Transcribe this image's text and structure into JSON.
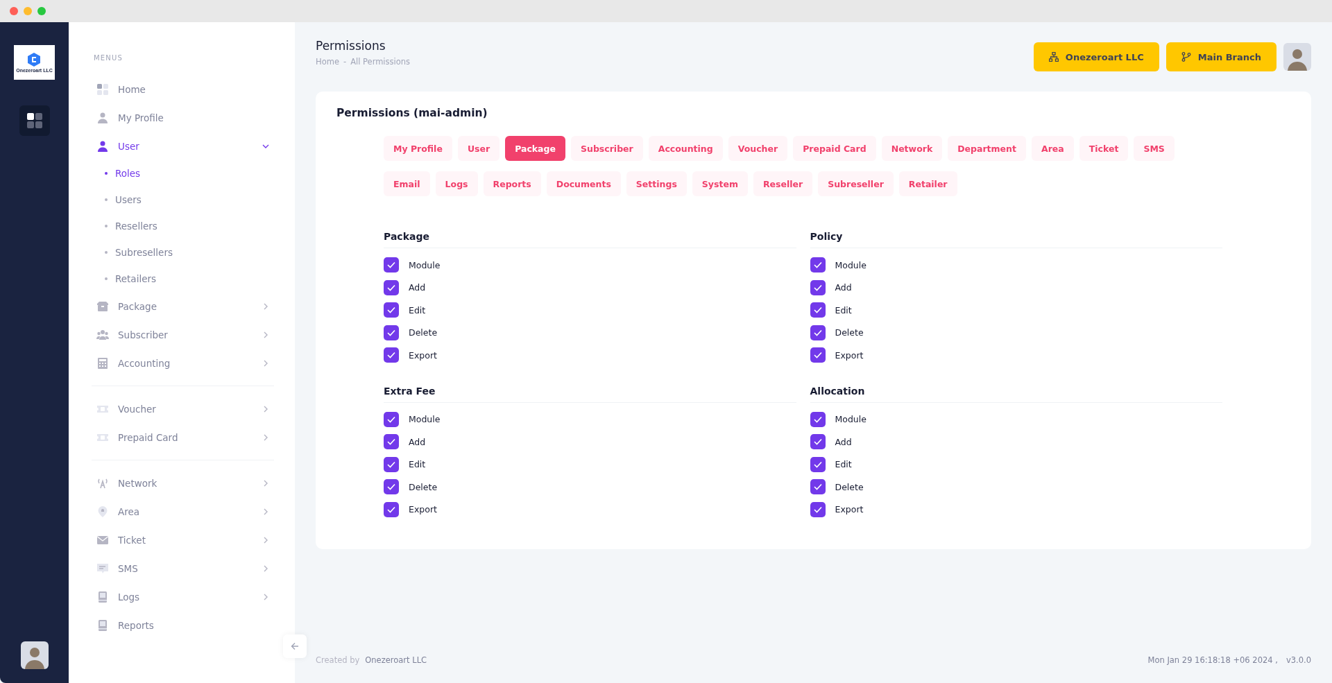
{
  "rail": {
    "logo_text": "Onezeroart LLC"
  },
  "sidebar": {
    "heading": "MENUS",
    "groups": [
      {
        "items": [
          {
            "label": "Home",
            "kind": "link",
            "active": false
          },
          {
            "label": "My Profile",
            "kind": "link",
            "active": false
          },
          {
            "label": "User",
            "kind": "menu",
            "active": true,
            "expanded": true,
            "children": [
              {
                "label": "Roles",
                "selected": true
              },
              {
                "label": "Users",
                "selected": false
              },
              {
                "label": "Resellers",
                "selected": false
              },
              {
                "label": "Subresellers",
                "selected": false
              },
              {
                "label": "Retailers",
                "selected": false
              }
            ]
          },
          {
            "label": "Package",
            "kind": "menu",
            "active": false,
            "expanded": false
          },
          {
            "label": "Subscriber",
            "kind": "menu",
            "active": false,
            "expanded": false
          },
          {
            "label": "Accounting",
            "kind": "menu",
            "active": false,
            "expanded": false
          }
        ]
      },
      {
        "items": [
          {
            "label": "Voucher",
            "kind": "menu",
            "active": false,
            "expanded": false
          },
          {
            "label": "Prepaid Card",
            "kind": "menu",
            "active": false,
            "expanded": false
          }
        ]
      },
      {
        "items": [
          {
            "label": "Network",
            "kind": "menu",
            "active": false,
            "expanded": false
          },
          {
            "label": "Area",
            "kind": "menu",
            "active": false,
            "expanded": false
          },
          {
            "label": "Ticket",
            "kind": "menu",
            "active": false,
            "expanded": false
          },
          {
            "label": "SMS",
            "kind": "menu",
            "active": false,
            "expanded": false
          },
          {
            "label": "Logs",
            "kind": "menu",
            "active": false,
            "expanded": false
          },
          {
            "label": "Reports",
            "kind": "link",
            "active": false
          }
        ]
      }
    ]
  },
  "header": {
    "title": "Permissions",
    "breadcrumb": [
      "Home",
      "All Permissions"
    ],
    "breadcrumb_separator": "-",
    "buttons": [
      {
        "label": "Onezeroart LLC",
        "kind": "organization"
      },
      {
        "label": "Main Branch",
        "kind": "branch"
      }
    ]
  },
  "card": {
    "title": "Permissions (mai-admin)",
    "tabs": [
      {
        "label": "My Profile",
        "selected": false
      },
      {
        "label": "User",
        "selected": false
      },
      {
        "label": "Package",
        "selected": true
      },
      {
        "label": "Subscriber",
        "selected": false
      },
      {
        "label": "Accounting",
        "selected": false
      },
      {
        "label": "Voucher",
        "selected": false
      },
      {
        "label": "Prepaid Card",
        "selected": false
      },
      {
        "label": "Network",
        "selected": false
      },
      {
        "label": "Department",
        "selected": false
      },
      {
        "label": "Area",
        "selected": false
      },
      {
        "label": "Ticket",
        "selected": false
      },
      {
        "label": "SMS",
        "selected": false
      },
      {
        "label": "Email",
        "selected": false
      },
      {
        "label": "Logs",
        "selected": false
      },
      {
        "label": "Reports",
        "selected": false
      },
      {
        "label": "Documents",
        "selected": false
      },
      {
        "label": "Settings",
        "selected": false
      },
      {
        "label": "System",
        "selected": false
      },
      {
        "label": "Reseller",
        "selected": false
      },
      {
        "label": "Subreseller",
        "selected": false
      },
      {
        "label": "Retailer",
        "selected": false
      }
    ],
    "sections": [
      {
        "title": "Package",
        "permissions": [
          {
            "label": "Module",
            "checked": true
          },
          {
            "label": "Add",
            "checked": true
          },
          {
            "label": "Edit",
            "checked": true
          },
          {
            "label": "Delete",
            "checked": true
          },
          {
            "label": "Export",
            "checked": true
          }
        ]
      },
      {
        "title": "Policy",
        "permissions": [
          {
            "label": "Module",
            "checked": true
          },
          {
            "label": "Add",
            "checked": true
          },
          {
            "label": "Edit",
            "checked": true
          },
          {
            "label": "Delete",
            "checked": true
          },
          {
            "label": "Export",
            "checked": true
          }
        ]
      },
      {
        "title": "Extra Fee",
        "permissions": [
          {
            "label": "Module",
            "checked": true
          },
          {
            "label": "Add",
            "checked": true
          },
          {
            "label": "Edit",
            "checked": true
          },
          {
            "label": "Delete",
            "checked": true
          },
          {
            "label": "Export",
            "checked": true
          }
        ]
      },
      {
        "title": "Allocation",
        "permissions": [
          {
            "label": "Module",
            "checked": true
          },
          {
            "label": "Add",
            "checked": true
          },
          {
            "label": "Edit",
            "checked": true
          },
          {
            "label": "Delete",
            "checked": true
          },
          {
            "label": "Export",
            "checked": true
          }
        ]
      }
    ]
  },
  "footer": {
    "created_by": "Created by",
    "company": "Onezeroart LLC",
    "timestamp": "Mon Jan 29 16:18:18 +06 2024 ,",
    "version": "v3.0.0"
  }
}
